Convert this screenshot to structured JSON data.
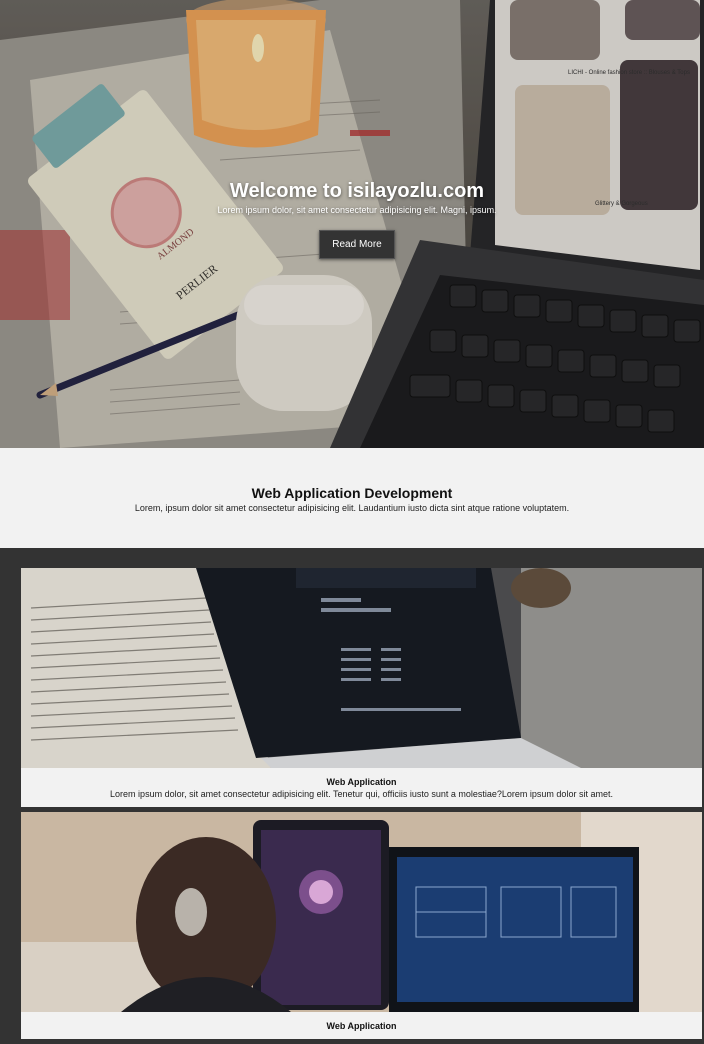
{
  "hero": {
    "title": "Welcome to isilayozlu.com",
    "subtitle": "Lorem ipsum dolor, sit amet consectetur adipisicing elit. Magni, ipsum.",
    "button_label": "Read More",
    "tube_label": "ALMOND",
    "tube_brand": "PERLIER",
    "screen_caption_1": "LICHI - Online fashion store :: Blouses & Tops",
    "screen_caption_2": "Glittery & Gorgeous"
  },
  "intro": {
    "title": "Web Application Development",
    "text": "Lorem, ipsum dolor sit amet consectetur adipisicing elit. Laudantium iusto dicta sint atque ratione voluptatem."
  },
  "cards": [
    {
      "title": "Web Application",
      "text": "Lorem ipsum dolor, sit amet consectetur adipisicing elit. Tenetur qui, officiis iusto sunt a molestiae?Lorem ipsum dolor sit amet."
    },
    {
      "title": "Web Application",
      "text": ""
    }
  ]
}
